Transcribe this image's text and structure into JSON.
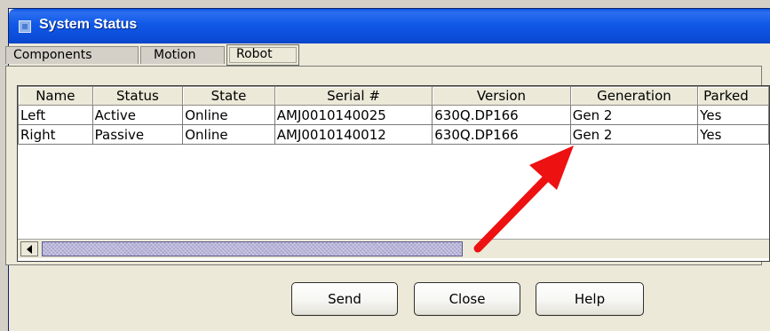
{
  "window": {
    "title": "System Status"
  },
  "tabs": [
    {
      "label": "Components",
      "selected": false
    },
    {
      "label": "Motion",
      "selected": false
    },
    {
      "label": "Robot",
      "selected": true
    }
  ],
  "table": {
    "columns": [
      "Name",
      "Status",
      "State",
      "Serial #",
      "Version",
      "Generation",
      "Parked"
    ],
    "rows": [
      [
        "Left",
        "Active",
        "Online",
        "AMJ0010140025",
        "630Q.DP166",
        "Gen 2",
        "Yes"
      ],
      [
        "Right",
        "Passive",
        "Online",
        "AMJ0010140012",
        "630Q.DP166",
        "Gen 2",
        "Yes"
      ]
    ]
  },
  "buttons": {
    "send": "Send",
    "close": "Close",
    "help": "Help"
  },
  "colors": {
    "titlebar": "#0b4cd8",
    "annotation_arrow": "#ee1111"
  }
}
